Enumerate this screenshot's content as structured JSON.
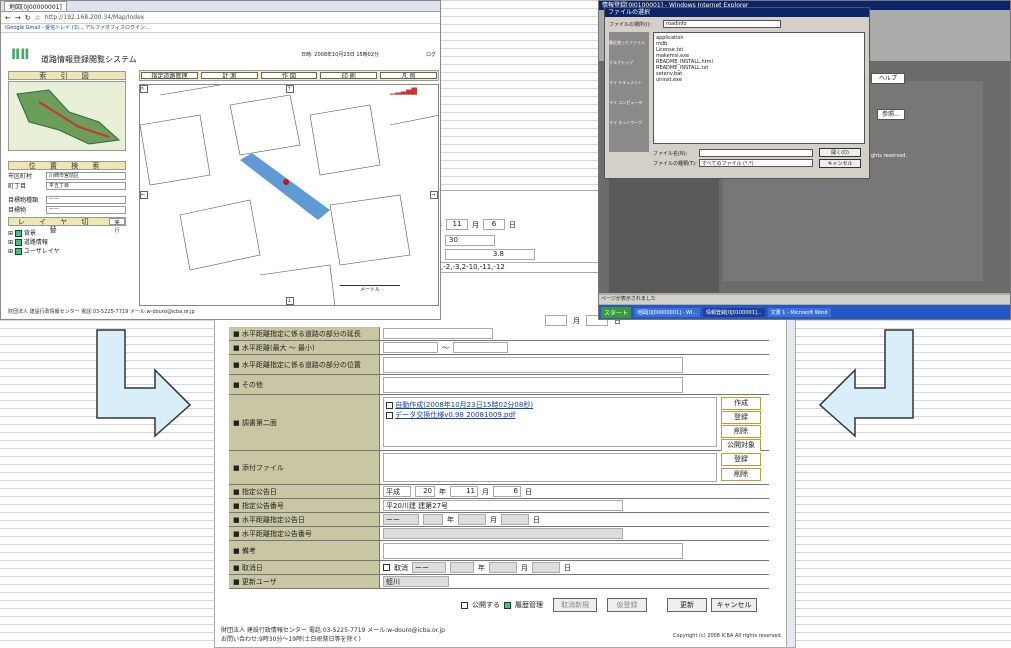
{
  "browser": {
    "tab_title": "地図[0J00000001]",
    "url": "http://192.168.200.34/Map/Index",
    "bookmarks": "iGoogle  Gmail - 受信トレイ (3)...  アルファオフィスログイン...",
    "app_title": "道路情報登録閲覧システム",
    "date": "日時: 2008年10月23日 15時02分",
    "logout": "ログ",
    "menu": [
      "指定道路管理",
      "計 測",
      "作 図",
      "印 刷",
      "凡 例"
    ],
    "index_title": "索 引 図",
    "location_title": "位 置 検 索",
    "location_fields": [
      {
        "label": "市区町村",
        "value": "川崎市宮前区"
      },
      {
        "label": "町丁目",
        "value": "平五丁目"
      },
      {
        "label": "目標物種類",
        "value": "ーー"
      },
      {
        "label": "目標物",
        "value": "ーー"
      }
    ],
    "layer_title": "レ イ ヤ 切 替",
    "layer_run": "実行",
    "layers": [
      "背景",
      "道路情報",
      "ユーザレイヤ"
    ],
    "scale_label": "メートル",
    "footer": "財団法人 建設行政情報センター  電話:03-5225-7719  メール:w-douro@icba.or.jp"
  },
  "file_dialog": {
    "window_title": "情報登録[0J0100001] - Windows Internet Explorer",
    "dialog_title": "ファイルの選択",
    "location_label": "ファイルの場所(I):",
    "location_value": "roadinfo",
    "files": [
      "application",
      "mdb",
      "License.txt",
      "makemsi.exe",
      "README_INSTALL.html",
      "README_INSTALL.txt",
      "setenv.bat",
      "uninst.exe"
    ],
    "places": [
      "最近使ったファイル",
      "デスクトップ",
      "マイ ドキュメント",
      "マイ コンピュータ",
      "マイ ネットワーク"
    ],
    "filename_label": "ファイル名(N):",
    "filetype_label": "ファイルの種類(T):",
    "filetype_value": "すべてのファイル (*.*)",
    "open_btn": "開く(O)",
    "cancel_btn": "キャンセル",
    "help_btn": "ヘルプ",
    "ref_btn": "参照...",
    "reserved": "ghts reserved.",
    "status": "ページが表示されました",
    "taskbar": [
      "スタート",
      "地図[0J00000001] - Wi...",
      "情報登録[0J0100001]...",
      "文書 1 - Microsoft Word"
    ]
  },
  "form": {
    "partial_top": {
      "month": "11",
      "month_label": "月",
      "day": "6",
      "day_label": "日",
      "year_label": "年",
      "v30": "30",
      "v38": "3.8",
      "list": ",-2,-3,2-10,-11,-12"
    },
    "rows": [
      {
        "label": "■ 水平距離指定に係る道路の部分の延長"
      },
      {
        "label": "■ 水平距離(最大 〜 最小)",
        "tilde": "〜"
      },
      {
        "label": "■ 水平距離指定に係る道路の部分の位置"
      },
      {
        "label": "■ その他"
      },
      {
        "label": "■ 調書第二面"
      },
      {
        "label": "■ 添付ファイル"
      },
      {
        "label": "■ 指定公告日"
      },
      {
        "label": "■ 指定公告番号"
      },
      {
        "label": "■ 水平距離指定公告日"
      },
      {
        "label": "■ 水平距離指定公告番号"
      },
      {
        "label": "■ 備考"
      },
      {
        "label": "■ 取消日"
      },
      {
        "label": "■ 更新ユーザ"
      }
    ],
    "doc_links": [
      "自動作成(2008年10月23日15時02分08秒)",
      "データ交換仕様v0.98 20081009.pdf"
    ],
    "doc_buttons": [
      "作成",
      "登録",
      "削除",
      "公開対象"
    ],
    "attach_buttons": [
      "登録",
      "削除"
    ],
    "notice_date": {
      "era": "平成",
      "year": "20",
      "year_label": "年",
      "month": "11",
      "month_label": "月",
      "day": "6",
      "day_label": "日"
    },
    "notice_number": "平20川建 建第27号",
    "h_notice": {
      "era": "ーー",
      "year_label": "年",
      "month_label": "月",
      "day_label": "日"
    },
    "cancel": {
      "check_label": "取消",
      "era": "ーー",
      "year_label": "年",
      "month_label": "月",
      "day_label": "日"
    },
    "update_user": "蛭川",
    "bottom": {
      "publish": "公開する",
      "history": "履歴管理",
      "cancel_new": "取消新規",
      "temp_reg": "仮登録",
      "update": "更新",
      "cancel": "キャンセル"
    },
    "footer1": "財団法人 建設行政情報センター  電話:03-5225-7719  メール:w-douro@icba.or.jp",
    "footer2": "お問い合わせ:9時30分〜19時(土日祝祭日等を除く)",
    "copyright": "Copyright (c) 2008 ICBA All rights reserved."
  },
  "colors": {
    "label_bg": "#c9c7a3",
    "arrow": "#d8eef8",
    "road": "#4f8fcf",
    "accent_btn": "#c49a3a"
  }
}
